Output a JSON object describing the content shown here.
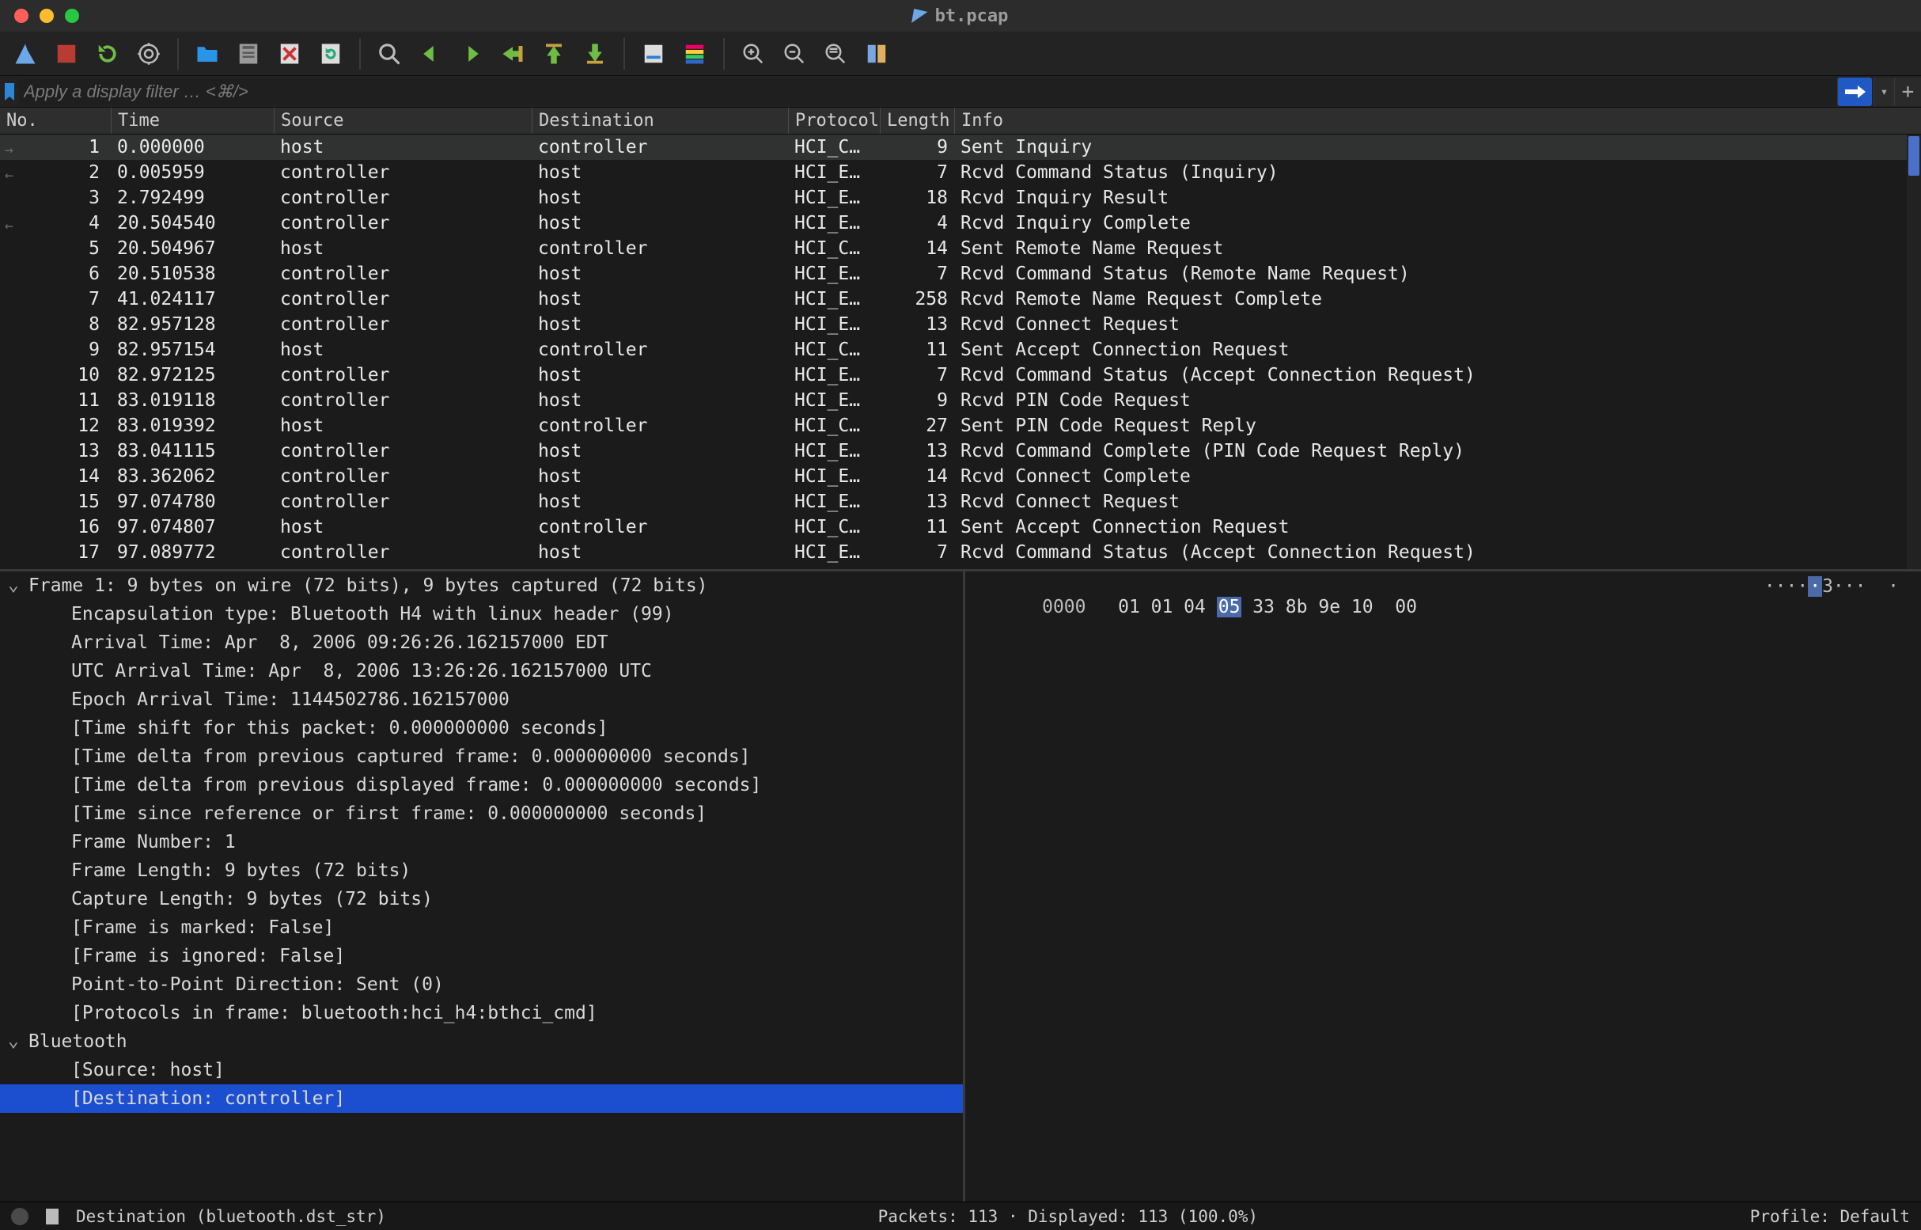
{
  "title": "bt.pcap",
  "filter_placeholder": "Apply a display filter … <⌘/>",
  "columns": {
    "no": "No.",
    "time": "Time",
    "src": "Source",
    "dst": "Destination",
    "proto": "Protocol",
    "len": "Length",
    "info": "Info"
  },
  "packets": [
    {
      "no": "1",
      "time": "0.000000",
      "src": "host",
      "dst": "controller",
      "proto": "HCI_C…",
      "len": "9",
      "info": "Sent Inquiry",
      "sel": true,
      "mark": "→"
    },
    {
      "no": "2",
      "time": "0.005959",
      "src": "controller",
      "dst": "host",
      "proto": "HCI_E…",
      "len": "7",
      "info": "Rcvd Command Status (Inquiry)",
      "mark": "←"
    },
    {
      "no": "3",
      "time": "2.792499",
      "src": "controller",
      "dst": "host",
      "proto": "HCI_E…",
      "len": "18",
      "info": "Rcvd Inquiry Result"
    },
    {
      "no": "4",
      "time": "20.504540",
      "src": "controller",
      "dst": "host",
      "proto": "HCI_E…",
      "len": "4",
      "info": "Rcvd Inquiry Complete",
      "mark": "←"
    },
    {
      "no": "5",
      "time": "20.504967",
      "src": "host",
      "dst": "controller",
      "proto": "HCI_C…",
      "len": "14",
      "info": "Sent Remote Name Request"
    },
    {
      "no": "6",
      "time": "20.510538",
      "src": "controller",
      "dst": "host",
      "proto": "HCI_E…",
      "len": "7",
      "info": "Rcvd Command Status (Remote Name Request)"
    },
    {
      "no": "7",
      "time": "41.024117",
      "src": "controller",
      "dst": "host",
      "proto": "HCI_E…",
      "len": "258",
      "info": "Rcvd Remote Name Request Complete"
    },
    {
      "no": "8",
      "time": "82.957128",
      "src": "controller",
      "dst": "host",
      "proto": "HCI_E…",
      "len": "13",
      "info": "Rcvd Connect Request"
    },
    {
      "no": "9",
      "time": "82.957154",
      "src": "host",
      "dst": "controller",
      "proto": "HCI_C…",
      "len": "11",
      "info": "Sent Accept Connection Request"
    },
    {
      "no": "10",
      "time": "82.972125",
      "src": "controller",
      "dst": "host",
      "proto": "HCI_E…",
      "len": "7",
      "info": "Rcvd Command Status (Accept Connection Request)"
    },
    {
      "no": "11",
      "time": "83.019118",
      "src": "controller",
      "dst": "host",
      "proto": "HCI_E…",
      "len": "9",
      "info": "Rcvd PIN Code Request"
    },
    {
      "no": "12",
      "time": "83.019392",
      "src": "host",
      "dst": "controller",
      "proto": "HCI_C…",
      "len": "27",
      "info": "Sent PIN Code Request Reply"
    },
    {
      "no": "13",
      "time": "83.041115",
      "src": "controller",
      "dst": "host",
      "proto": "HCI_E…",
      "len": "13",
      "info": "Rcvd Command Complete (PIN Code Request Reply)"
    },
    {
      "no": "14",
      "time": "83.362062",
      "src": "controller",
      "dst": "host",
      "proto": "HCI_E…",
      "len": "14",
      "info": "Rcvd Connect Complete"
    },
    {
      "no": "15",
      "time": "97.074780",
      "src": "controller",
      "dst": "host",
      "proto": "HCI_E…",
      "len": "13",
      "info": "Rcvd Connect Request"
    },
    {
      "no": "16",
      "time": "97.074807",
      "src": "host",
      "dst": "controller",
      "proto": "HCI_C…",
      "len": "11",
      "info": "Sent Accept Connection Request"
    },
    {
      "no": "17",
      "time": "97.089772",
      "src": "controller",
      "dst": "host",
      "proto": "HCI_E…",
      "len": "7",
      "info": "Rcvd Command Status (Accept Connection Request)"
    }
  ],
  "tree": {
    "frame_header": "Frame 1: 9 bytes on wire (72 bits), 9 bytes captured (72 bits)",
    "lines": [
      "Encapsulation type: Bluetooth H4 with linux header (99)",
      "Arrival Time: Apr  8, 2006 09:26:26.162157000 EDT",
      "UTC Arrival Time: Apr  8, 2006 13:26:26.162157000 UTC",
      "Epoch Arrival Time: 1144502786.162157000",
      "[Time shift for this packet: 0.000000000 seconds]",
      "[Time delta from previous captured frame: 0.000000000 seconds]",
      "[Time delta from previous displayed frame: 0.000000000 seconds]",
      "[Time since reference or first frame: 0.000000000 seconds]",
      "Frame Number: 1",
      "Frame Length: 9 bytes (72 bits)",
      "Capture Length: 9 bytes (72 bits)",
      "[Frame is marked: False]",
      "[Frame is ignored: False]",
      "Point-to-Point Direction: Sent (0)",
      "[Protocols in frame: bluetooth:hci_h4:bthci_cmd]"
    ],
    "bt_header": "Bluetooth",
    "bt_lines": [
      "[Source: host]",
      "[Destination: controller]"
    ]
  },
  "bytes": {
    "offset": "0000",
    "hex_pre": "01 01 04 ",
    "hex_hl": "05",
    "hex_post": " 33 8b 9e 10  00",
    "ascii_pre": "····",
    "ascii_hl": "·",
    "ascii_post": "3···  ·"
  },
  "status": {
    "field": "Destination (bluetooth.dst_str)",
    "packets": "Packets: 113 · Displayed: 113 (100.0%)",
    "profile": "Profile: Default"
  },
  "toolbar_icons": [
    "start-capture",
    "stop-capture",
    "restart-capture",
    "capture-options",
    "sep",
    "open-file",
    "save-file",
    "close-file",
    "reload-file",
    "sep",
    "find-packet",
    "go-back",
    "go-forward",
    "go-to-packet",
    "go-first",
    "go-last",
    "sep",
    "auto-scroll",
    "colorize",
    "sep",
    "zoom-in",
    "zoom-out",
    "zoom-reset",
    "resize-columns"
  ]
}
